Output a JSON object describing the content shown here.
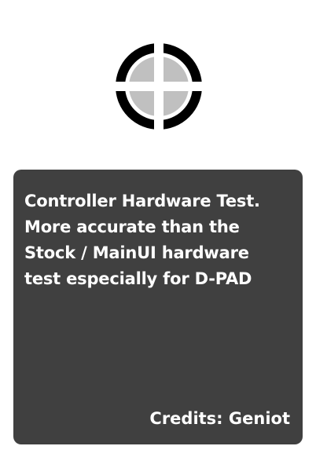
{
  "app": {
    "icon": "crosshair-target-icon",
    "colors": {
      "ring": "#000000",
      "fill": "#c0c0c0",
      "panel": "#404040",
      "text": "#ffffff",
      "background": "#ffffff"
    }
  },
  "info": {
    "description_lines": [
      "Controller Hardware Test.",
      "More accurate than the",
      "Stock / MainUI hardware",
      "test especially for D-PAD"
    ],
    "credits": "Credits: Geniot"
  }
}
